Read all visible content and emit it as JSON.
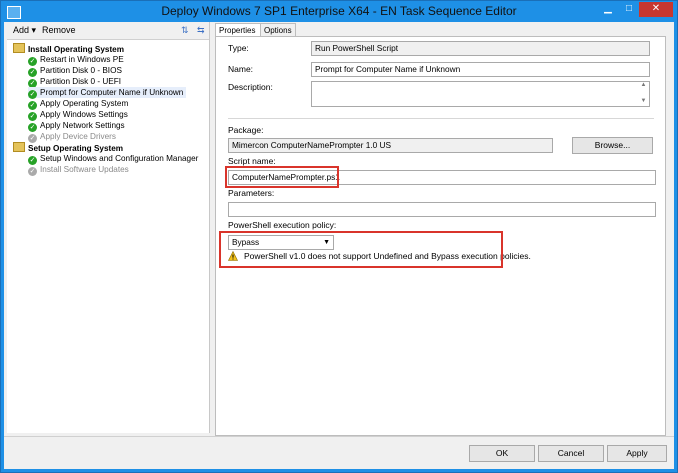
{
  "window": {
    "title": "Deploy Windows 7 SP1 Enterprise X64 - EN Task Sequence Editor",
    "controls": {
      "minimize": "▁",
      "maximize": "□",
      "close": "✕"
    }
  },
  "left_toolbar": {
    "add_label": "Add",
    "remove_label": "Remove"
  },
  "tree": {
    "groups": [
      {
        "label": "Install Operating System"
      },
      {
        "label": "Setup Operating System"
      }
    ],
    "items": [
      {
        "label": "Restart in Windows PE"
      },
      {
        "label": "Partition Disk 0 - BIOS"
      },
      {
        "label": "Partition Disk 0 - UEFI"
      },
      {
        "label": "Prompt for Computer Name if Unknown"
      },
      {
        "label": "Apply Operating System"
      },
      {
        "label": "Apply Windows Settings"
      },
      {
        "label": "Apply Network Settings"
      },
      {
        "label": "Apply Device Drivers"
      },
      {
        "label": "Setup Windows and Configuration Manager"
      },
      {
        "label": "Install Software Updates"
      }
    ]
  },
  "tabs": {
    "properties": "Properties",
    "options": "Options"
  },
  "properties": {
    "type_label": "Type:",
    "type_value": "Run PowerShell Script",
    "name_label": "Name:",
    "name_value": "Prompt for Computer Name if Unknown",
    "description_label": "Description:",
    "package_label": "Package:",
    "package_value": "Mimercon ComputerNamePrompter 1.0 US",
    "browse_label": "Browse...",
    "script_label": "Script name:",
    "script_value": "ComputerNamePrompter.ps1",
    "parameters_label": "Parameters:",
    "policy_label": "PowerShell execution policy:",
    "policy_value": "Bypass",
    "warning_text": "PowerShell v1.0 does not support Undefined and Bypass execution policies."
  },
  "buttons": {
    "ok": "OK",
    "cancel": "Cancel",
    "apply": "Apply"
  },
  "colors": {
    "title_bar": "#1e90e6",
    "close_button": "#c7372f",
    "highlight_box": "#d9342b",
    "check_icon": "#27a227"
  }
}
